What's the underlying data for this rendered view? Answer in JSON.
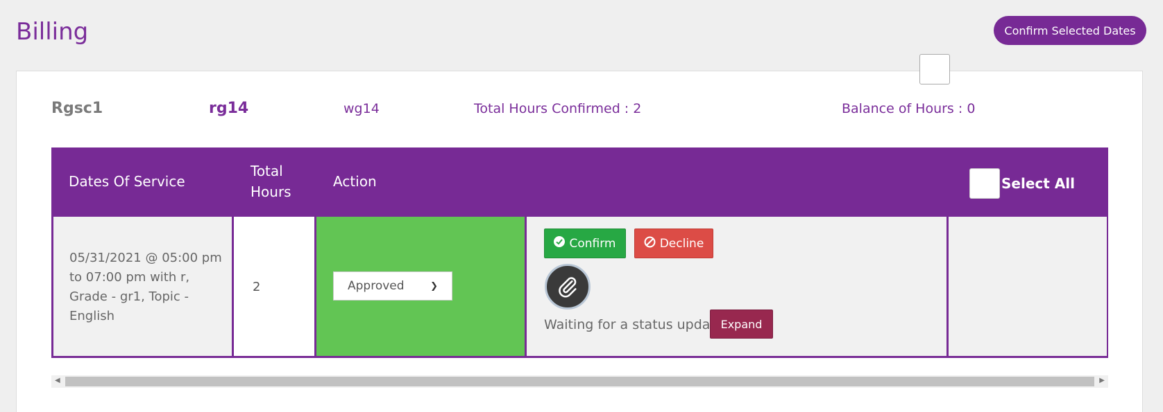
{
  "page": {
    "title": "Billing"
  },
  "header": {
    "confirm_button": "Confirm Selected Dates"
  },
  "summary": {
    "name": "Rgsc1",
    "code1": "rg14",
    "code2": "wg14",
    "total_confirmed": "Total Hours Confirmed : 2",
    "balance": "Balance of Hours : 0"
  },
  "table": {
    "headers": {
      "dates": "Dates Of Service",
      "hours": "Total Hours",
      "action": "Action",
      "select_all": "Select All"
    },
    "rows": [
      {
        "dates": "05/31/2021 @ 05:00 pm to 07:00 pm with r, Grade - gr1, Topic - English",
        "hours": "2",
        "status": "Approved",
        "confirm_label": "Confirm",
        "decline_label": "Decline",
        "attachment_icon": "paperclip-icon",
        "status_text": "Waiting for a status update.",
        "expand_label": "Expand",
        "checked": false
      }
    ]
  },
  "colors": {
    "brand": "#772a95",
    "approved": "#62c554",
    "confirm": "#27a844",
    "decline": "#dc4c46",
    "expand": "#98284f"
  }
}
